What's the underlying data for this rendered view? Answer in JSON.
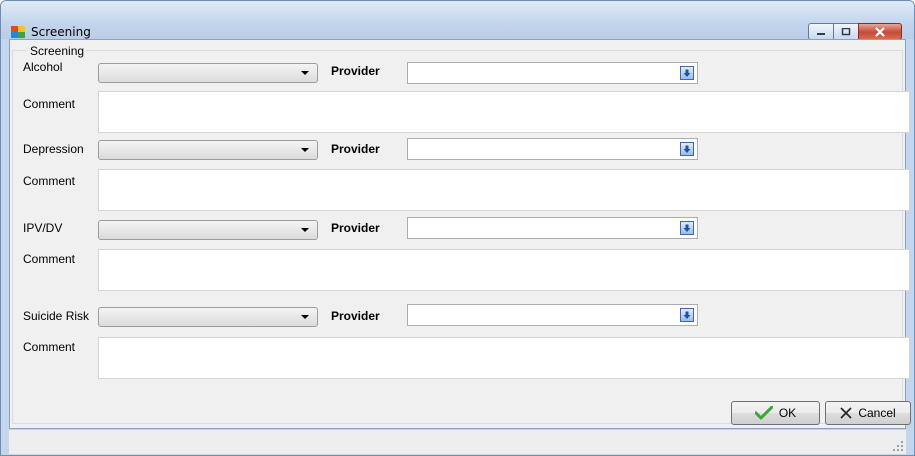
{
  "window": {
    "title": "Screening",
    "controls": [
      "minimize",
      "maximize",
      "close"
    ]
  },
  "group": {
    "label": "Screening"
  },
  "rows": [
    {
      "label": "Alcohol",
      "select_value": "",
      "provider_label": "Provider",
      "provider_value": "",
      "comment_label": "Comment",
      "comment_value": ""
    },
    {
      "label": "Depression",
      "select_value": "",
      "provider_label": "Provider",
      "provider_value": "",
      "comment_label": "Comment",
      "comment_value": ""
    },
    {
      "label": "IPV/DV",
      "select_value": "",
      "provider_label": "Provider",
      "provider_value": "",
      "comment_label": "Comment",
      "comment_value": ""
    },
    {
      "label": "Suicide Risk",
      "select_value": "",
      "provider_label": "Provider",
      "provider_value": "",
      "comment_label": "Comment",
      "comment_value": ""
    }
  ],
  "buttons": {
    "ok": "OK",
    "cancel": "Cancel"
  },
  "icons": {
    "window": "form-icon",
    "provider_picker": "arrow-down-icon",
    "ok": "check-icon",
    "cancel": "x-icon"
  },
  "colors": {
    "accent_check": "#3fa535",
    "close_button": "#c74a36",
    "titlebar": "#c2d5ec"
  }
}
